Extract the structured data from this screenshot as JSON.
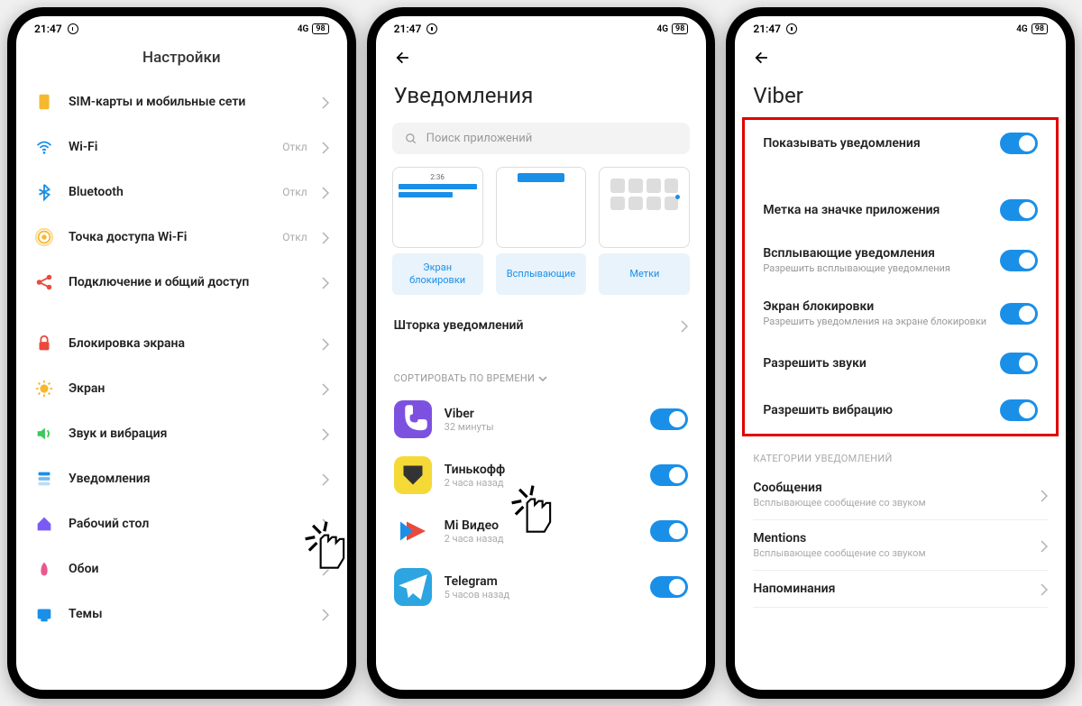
{
  "status": {
    "time": "21:47",
    "battery": "98",
    "signal": "4G"
  },
  "screen1": {
    "title": "Настройки",
    "items": [
      {
        "icon": "sim",
        "label": "SIM-карты и мобильные сети",
        "color": "#f5b82e"
      },
      {
        "icon": "wifi",
        "label": "Wi-Fi",
        "value": "Откл",
        "color": "#1a8fe8"
      },
      {
        "icon": "bluetooth",
        "label": "Bluetooth",
        "value": "Откл",
        "color": "#1a8fe8"
      },
      {
        "icon": "hotspot",
        "label": "Точка доступа Wi-Fi",
        "value": "Откл",
        "color": "#f5b82e"
      },
      {
        "icon": "share",
        "label": "Подключение и общий доступ",
        "color": "#e84a3c"
      }
    ],
    "items2": [
      {
        "icon": "lock",
        "label": "Блокировка экрана",
        "color": "#e84a3c"
      },
      {
        "icon": "display",
        "label": "Экран",
        "color": "#f5b82e"
      },
      {
        "icon": "sound",
        "label": "Звук и вибрация",
        "color": "#3cc85a"
      },
      {
        "icon": "notifications",
        "label": "Уведомления",
        "color": "#1a8fe8"
      },
      {
        "icon": "home",
        "label": "Рабочий стол",
        "color": "#7a5af5"
      },
      {
        "icon": "wallpaper",
        "label": "Обои",
        "color": "#e85a8f"
      },
      {
        "icon": "themes",
        "label": "Темы",
        "color": "#1a8fe8"
      }
    ]
  },
  "screen2": {
    "title": "Уведомления",
    "searchPlaceholder": "Поиск приложений",
    "modes": [
      {
        "label": "Экран блокировки",
        "type": "lock",
        "time": "2:36"
      },
      {
        "label": "Всплывающие",
        "type": "popup"
      },
      {
        "label": "Метки",
        "type": "badges"
      }
    ],
    "shade": "Шторка уведомлений",
    "sortLabel": "СОРТИРОВАТЬ ПО ВРЕМЕНИ",
    "apps": [
      {
        "name": "Viber",
        "time": "32 минуты",
        "bg": "#7d51e0",
        "icon": "viber"
      },
      {
        "name": "Тинькофф",
        "time": "2 часа назад",
        "bg": "#f5d936",
        "icon": "tinkoff"
      },
      {
        "name": "Mi Видео",
        "time": "2 часа назад",
        "bg": "#ffffff",
        "icon": "mivideo"
      },
      {
        "name": "Telegram",
        "time": "5 часов назад",
        "bg": "#2ca5e0",
        "icon": "telegram"
      }
    ]
  },
  "screen3": {
    "title": "Viber",
    "toggles": [
      {
        "title": "Показывать уведомления"
      },
      {
        "sep": true
      },
      {
        "title": "Метка на значке приложения"
      },
      {
        "title": "Всплывающие уведомления",
        "sub": "Разрешить всплывающие уведомления"
      },
      {
        "title": "Экран блокировки",
        "sub": "Разрешить уведомления на экране блокировки"
      },
      {
        "title": "Разрешить звуки"
      },
      {
        "title": "Разрешить вибрацию"
      }
    ],
    "categoriesLabel": "КАТЕГОРИИ УВЕДОМЛЕНИЙ",
    "categories": [
      {
        "title": "Сообщения",
        "sub": "Всплывающее сообщение со звуком"
      },
      {
        "title": "Mentions",
        "sub": "Всплывающее сообщение со звуком"
      },
      {
        "title": "Напоминания"
      }
    ]
  }
}
